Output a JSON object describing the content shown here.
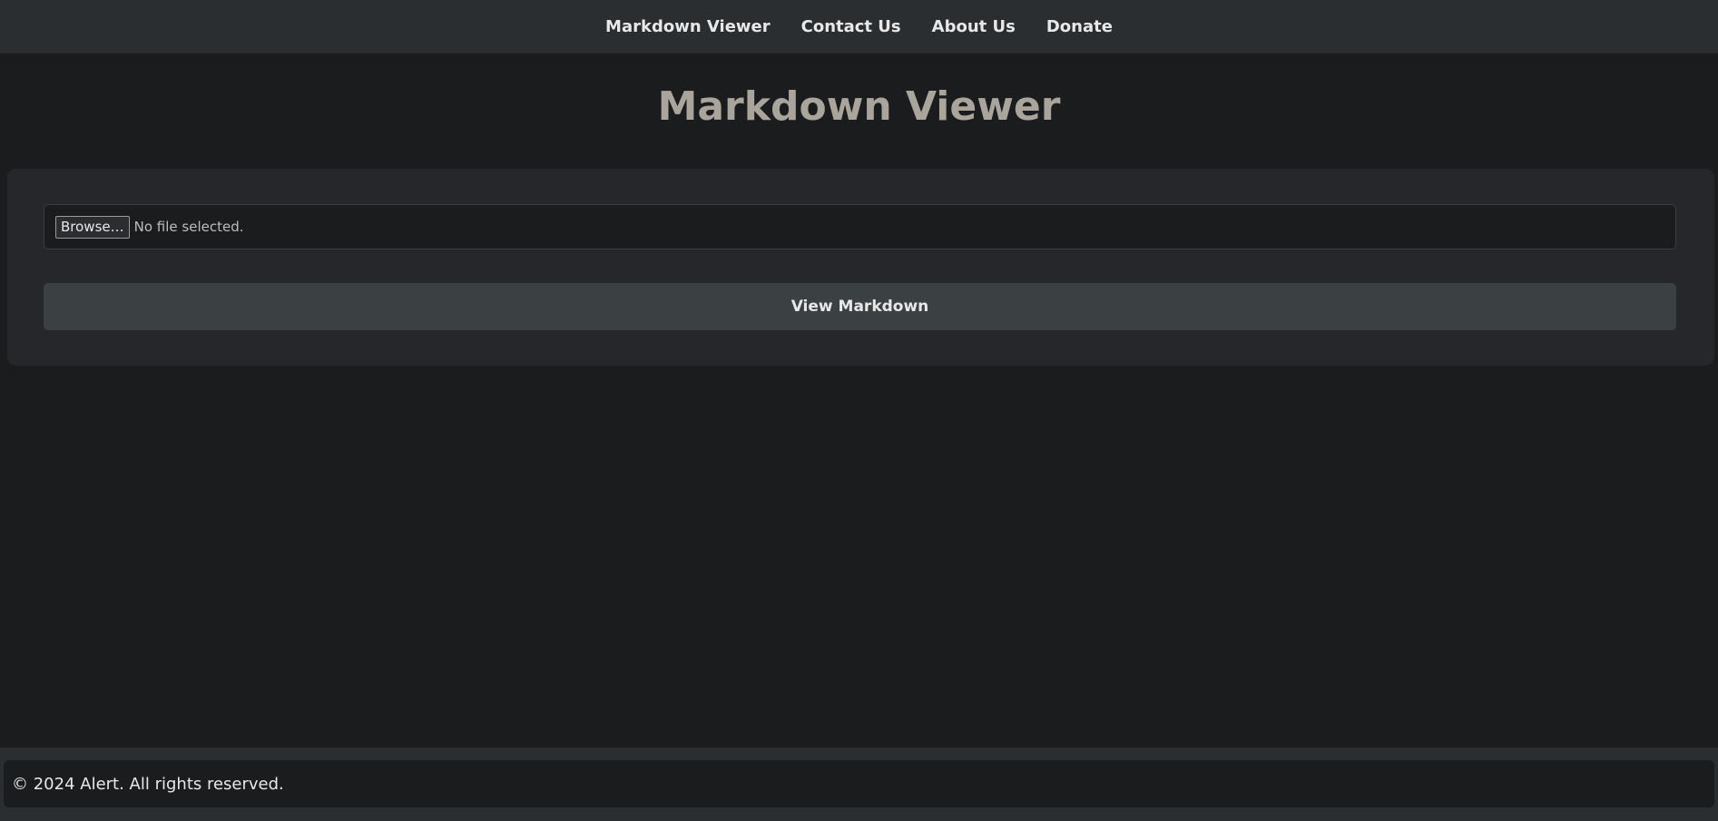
{
  "nav": {
    "items": [
      {
        "label": "Markdown Viewer"
      },
      {
        "label": "Contact Us"
      },
      {
        "label": "About Us"
      },
      {
        "label": "Donate"
      }
    ]
  },
  "main": {
    "title": "Markdown Viewer",
    "file_input": {
      "browse_label": "Browse…",
      "status": "No file selected."
    },
    "view_button_label": "View Markdown"
  },
  "footer": {
    "text": "© 2024 Alert. All rights reserved."
  },
  "colors": {
    "background": "#1b1c1e",
    "navbar": "#2b2e31",
    "card": "#25272a",
    "title": "#aaa59c",
    "button": "#3b4043"
  }
}
